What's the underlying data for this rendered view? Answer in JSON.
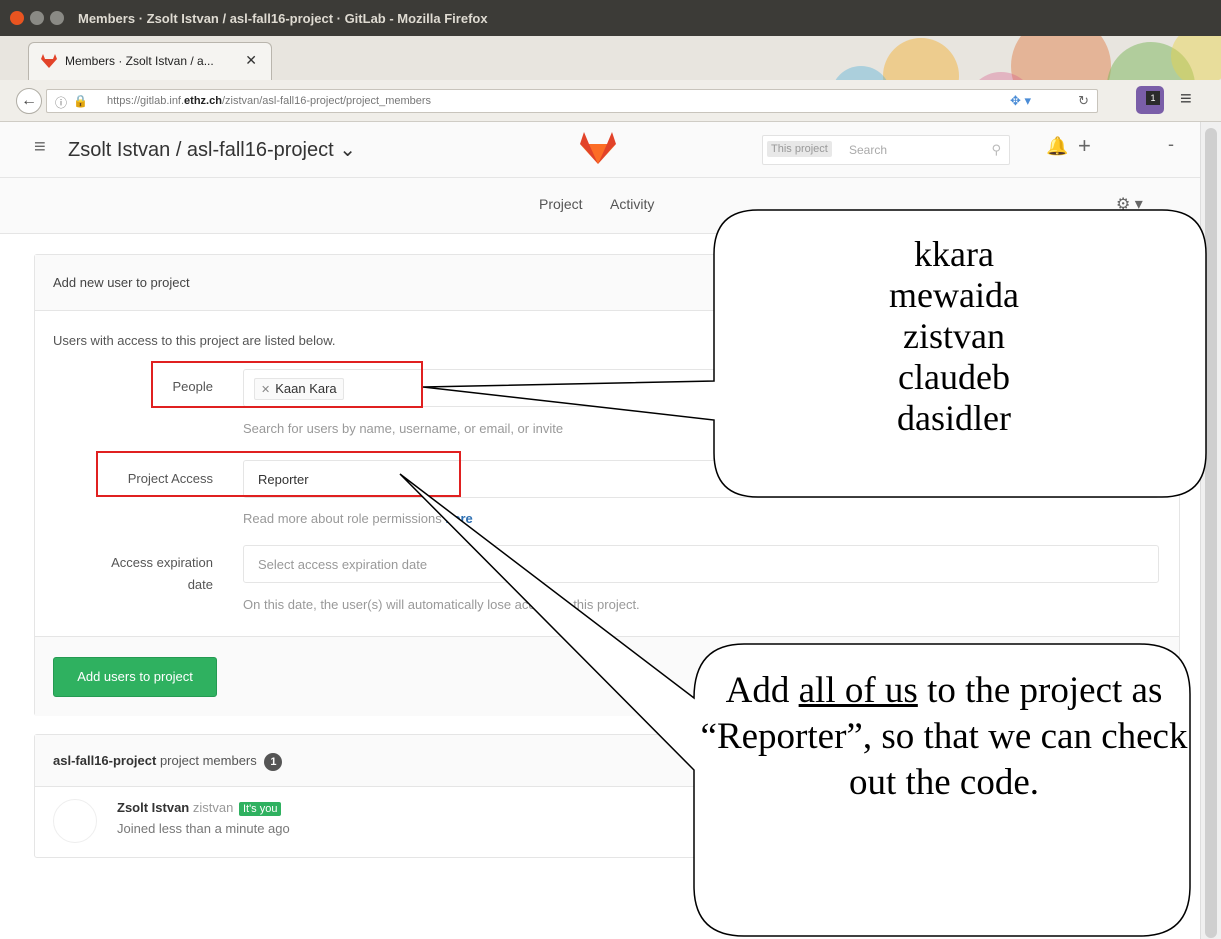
{
  "os": {
    "window_title": "Members · Zsolt Istvan / asl-fall16-project · GitLab - Mozilla Firefox"
  },
  "browser": {
    "tab_title": "Members · Zsolt Istvan / a...",
    "url_prefix": "https://gitlab.inf.",
    "url_domain": "ethz.ch",
    "url_path": "/zistvan/asl-fall16-project/project_members",
    "extension_badge": "1"
  },
  "header": {
    "project_title": "Zsolt Istvan / asl-fall16-project ⌄",
    "search_scope": "This project",
    "search_placeholder": "Search"
  },
  "subnav": {
    "links": [
      "Project",
      "Activity"
    ]
  },
  "add_user_panel": {
    "title": "Add new user to project",
    "intro": "Users with access to this project are listed below.",
    "people_label": "People",
    "people_token": "Kaan Kara",
    "people_help": "Search for users by name, username, or email, or invite",
    "access_label": "Project Access",
    "access_value": "Reporter",
    "access_help_prefix": "Read more about role permissions ",
    "access_help_link": "here",
    "expiration_label_1": "Access expiration",
    "expiration_label_2": "date",
    "expiration_placeholder": "Select access expiration date",
    "expiration_help": "On this date, the user(s) will automatically lose access to this project.",
    "submit_label": "Add users to project"
  },
  "members_panel": {
    "project_name": "asl-fall16-project",
    "suffix": " project members",
    "count": "1",
    "member": {
      "name": "Zsolt Istvan",
      "username": "zistvan",
      "badge": "It's you",
      "joined": "Joined less than a minute ago"
    }
  },
  "annotations": {
    "users_callout": [
      "kkara",
      "mewaida",
      "zistvan",
      "claudeb",
      "dasidler"
    ],
    "note_before": "Add ",
    "note_underlined": "all of us",
    "note_after": " to the project as “Reporter”, so that we can check out the code."
  },
  "colors": {
    "primary_green": "#2fb160",
    "link_blue": "#2e70b3",
    "annotation_red": "#e02020",
    "gitlab_orange": "#e24329"
  }
}
